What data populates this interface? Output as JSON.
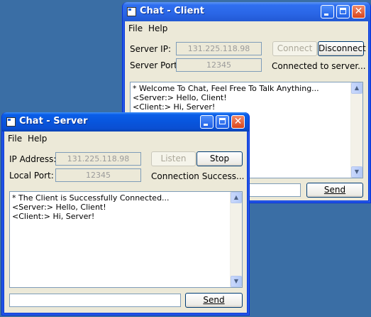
{
  "client": {
    "title": "Chat - Client",
    "menu": [
      "File",
      "Help"
    ],
    "server_ip_label": "Server IP:",
    "server_ip_value": "131.225.118.98",
    "server_port_label": "Server Port:",
    "server_port_value": "12345",
    "connect_label": "Connect",
    "disconnect_label": "Disconnect",
    "status": "Connected to server...",
    "messages": [
      "* Welcome To Chat, Feel Free To Talk Anything...",
      "<Server:> Hello, Client!",
      "<Client:> Hi, Server!"
    ],
    "send_label": "Send"
  },
  "server": {
    "title": "Chat - Server",
    "menu": [
      "File",
      "Help"
    ],
    "ip_label": "IP Address:",
    "ip_value": "131.225.118.98",
    "port_label": "Local Port:",
    "port_value": "12345",
    "listen_label": "Listen",
    "stop_label": "Stop",
    "status": "Connection Success...",
    "messages": [
      "* The Client is Successfully Connected...",
      "<Server:> Hello, Client!",
      "<Client:> Hi, Server!"
    ],
    "send_label": "Send"
  },
  "icons": {
    "app": "app-window-icon",
    "minimize": "minimize-icon",
    "maximize": "maximize-icon",
    "close": "close-icon",
    "scroll_up": "arrow-up-icon",
    "scroll_down": "arrow-down-icon"
  },
  "colors": {
    "desktop": "#3a6ea5",
    "titlebar": "#0855dd",
    "window_face": "#ece9d8"
  }
}
